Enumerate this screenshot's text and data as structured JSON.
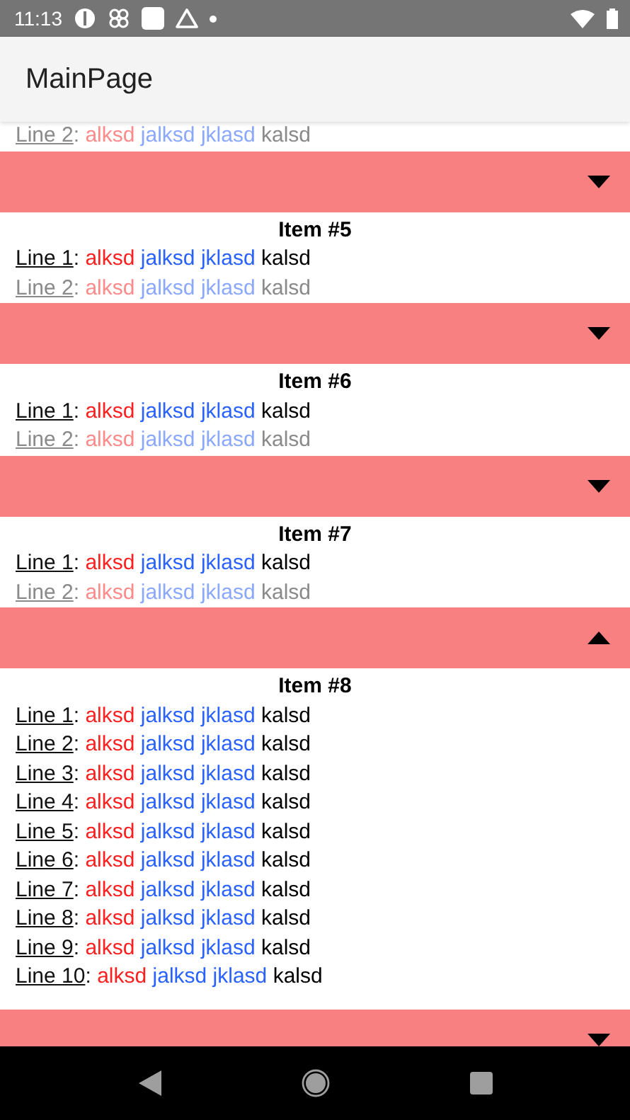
{
  "status_bar": {
    "time": "11:13"
  },
  "app_bar": {
    "title": "MainPage"
  },
  "top_fragment": {
    "lines": [
      {
        "label": "Line 2",
        "separator": ":",
        "faded": true,
        "words": [
          {
            "text": "alksd",
            "color": "#ff8a8a"
          },
          {
            "text": "jalksd",
            "color": "#8aa8ff"
          },
          {
            "text": "jklasd",
            "color": "#8aa8ff"
          },
          {
            "text": "kalsd",
            "color": "#8a8a8a"
          }
        ]
      }
    ]
  },
  "items": [
    {
      "title": "Item #5",
      "expanded": false,
      "lines": [
        {
          "label": "Line 1",
          "separator": ":",
          "faded": false,
          "words": [
            {
              "text": "alksd",
              "color": "#ff1f1f"
            },
            {
              "text": "jalksd",
              "color": "#2962ff"
            },
            {
              "text": "jklasd",
              "color": "#2962ff"
            },
            {
              "text": "kalsd",
              "color": "#000000"
            }
          ]
        },
        {
          "label": "Line 2",
          "separator": ":",
          "faded": true,
          "words": [
            {
              "text": "alksd",
              "color": "#ff8a8a"
            },
            {
              "text": "jalksd",
              "color": "#8aa8ff"
            },
            {
              "text": "jklasd",
              "color": "#8aa8ff"
            },
            {
              "text": "kalsd",
              "color": "#8a8a8a"
            }
          ]
        }
      ]
    },
    {
      "title": "Item #6",
      "expanded": false,
      "lines": [
        {
          "label": "Line 1",
          "separator": ":",
          "faded": false,
          "words": [
            {
              "text": "alksd",
              "color": "#ff1f1f"
            },
            {
              "text": "jalksd",
              "color": "#2962ff"
            },
            {
              "text": "jklasd",
              "color": "#2962ff"
            },
            {
              "text": "kalsd",
              "color": "#000000"
            }
          ]
        },
        {
          "label": "Line 2",
          "separator": ":",
          "faded": true,
          "words": [
            {
              "text": "alksd",
              "color": "#ff8a8a"
            },
            {
              "text": "jalksd",
              "color": "#8aa8ff"
            },
            {
              "text": "jklasd",
              "color": "#8aa8ff"
            },
            {
              "text": "kalsd",
              "color": "#8a8a8a"
            }
          ]
        }
      ]
    },
    {
      "title": "Item #7",
      "expanded": false,
      "lines": [
        {
          "label": "Line 1",
          "separator": ":",
          "faded": false,
          "words": [
            {
              "text": "alksd",
              "color": "#ff1f1f"
            },
            {
              "text": "jalksd",
              "color": "#2962ff"
            },
            {
              "text": "jklasd",
              "color": "#2962ff"
            },
            {
              "text": "kalsd",
              "color": "#000000"
            }
          ]
        },
        {
          "label": "Line 2",
          "separator": ":",
          "faded": true,
          "words": [
            {
              "text": "alksd",
              "color": "#ff8a8a"
            },
            {
              "text": "jalksd",
              "color": "#8aa8ff"
            },
            {
              "text": "jklasd",
              "color": "#8aa8ff"
            },
            {
              "text": "kalsd",
              "color": "#8a8a8a"
            }
          ]
        }
      ]
    },
    {
      "title": "Item #8",
      "expanded": true,
      "lines": [
        {
          "label": "Line 1",
          "separator": ":",
          "faded": false,
          "words": [
            {
              "text": "alksd",
              "color": "#ff1f1f"
            },
            {
              "text": "jalksd",
              "color": "#2962ff"
            },
            {
              "text": "jklasd",
              "color": "#2962ff"
            },
            {
              "text": "kalsd",
              "color": "#000000"
            }
          ]
        },
        {
          "label": "Line 2",
          "separator": ":",
          "faded": false,
          "words": [
            {
              "text": "alksd",
              "color": "#ff1f1f"
            },
            {
              "text": "jalksd",
              "color": "#2962ff"
            },
            {
              "text": "jklasd",
              "color": "#2962ff"
            },
            {
              "text": "kalsd",
              "color": "#000000"
            }
          ]
        },
        {
          "label": "Line 3",
          "separator": ":",
          "faded": false,
          "words": [
            {
              "text": "alksd",
              "color": "#ff1f1f"
            },
            {
              "text": "jalksd",
              "color": "#2962ff"
            },
            {
              "text": "jklasd",
              "color": "#2962ff"
            },
            {
              "text": "kalsd",
              "color": "#000000"
            }
          ]
        },
        {
          "label": "Line 4",
          "separator": ":",
          "faded": false,
          "words": [
            {
              "text": "alksd",
              "color": "#ff1f1f"
            },
            {
              "text": "jalksd",
              "color": "#2962ff"
            },
            {
              "text": "jklasd",
              "color": "#2962ff"
            },
            {
              "text": "kalsd",
              "color": "#000000"
            }
          ]
        },
        {
          "label": "Line 5",
          "separator": ":",
          "faded": false,
          "words": [
            {
              "text": "alksd",
              "color": "#ff1f1f"
            },
            {
              "text": "jalksd",
              "color": "#2962ff"
            },
            {
              "text": "jklasd",
              "color": "#2962ff"
            },
            {
              "text": "kalsd",
              "color": "#000000"
            }
          ]
        },
        {
          "label": "Line 6",
          "separator": ":",
          "faded": false,
          "words": [
            {
              "text": "alksd",
              "color": "#ff1f1f"
            },
            {
              "text": "jalksd",
              "color": "#2962ff"
            },
            {
              "text": "jklasd",
              "color": "#2962ff"
            },
            {
              "text": "kalsd",
              "color": "#000000"
            }
          ]
        },
        {
          "label": "Line 7",
          "separator": ":",
          "faded": false,
          "words": [
            {
              "text": "alksd",
              "color": "#ff1f1f"
            },
            {
              "text": "jalksd",
              "color": "#2962ff"
            },
            {
              "text": "jklasd",
              "color": "#2962ff"
            },
            {
              "text": "kalsd",
              "color": "#000000"
            }
          ]
        },
        {
          "label": "Line 8",
          "separator": ":",
          "faded": false,
          "words": [
            {
              "text": "alksd",
              "color": "#ff1f1f"
            },
            {
              "text": "jalksd",
              "color": "#2962ff"
            },
            {
              "text": "jklasd",
              "color": "#2962ff"
            },
            {
              "text": "kalsd",
              "color": "#000000"
            }
          ]
        },
        {
          "label": "Line 9",
          "separator": ":",
          "faded": false,
          "words": [
            {
              "text": "alksd",
              "color": "#ff1f1f"
            },
            {
              "text": "jalksd",
              "color": "#2962ff"
            },
            {
              "text": "jklasd",
              "color": "#2962ff"
            },
            {
              "text": "kalsd",
              "color": "#000000"
            }
          ]
        },
        {
          "label": "Line 10",
          "separator": ":",
          "faded": false,
          "words": [
            {
              "text": "alksd",
              "color": "#ff1f1f"
            },
            {
              "text": "jalksd",
              "color": "#2962ff"
            },
            {
              "text": "jklasd",
              "color": "#2962ff"
            },
            {
              "text": "kalsd",
              "color": "#000000"
            }
          ]
        }
      ]
    },
    {
      "expanded": false
    }
  ]
}
